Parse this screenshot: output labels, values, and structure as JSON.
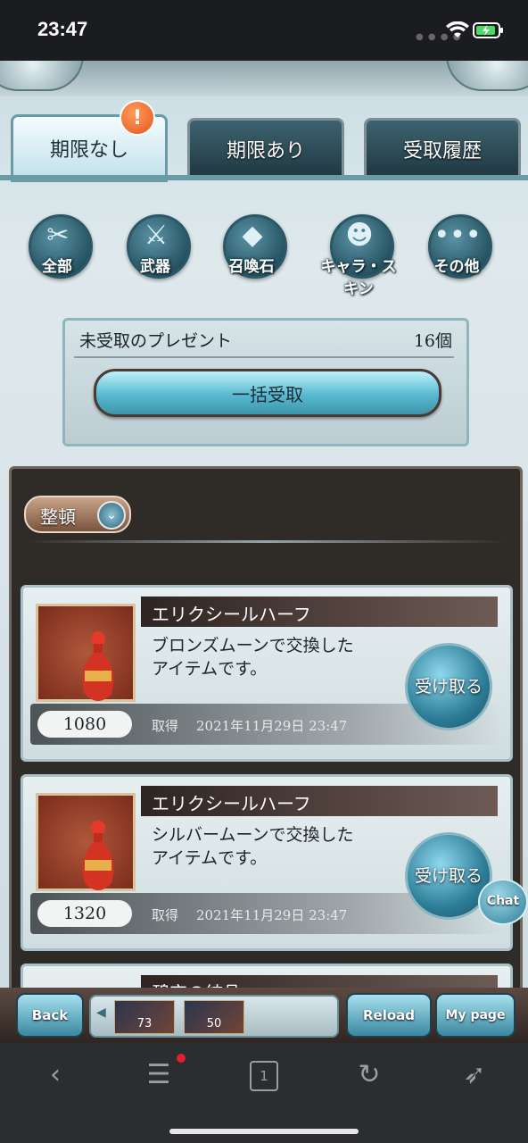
{
  "status_bar": {
    "time": "23:47"
  },
  "tabs": [
    {
      "label": "期限なし",
      "active": true
    },
    {
      "label": "期限あり",
      "active": false
    },
    {
      "label": "受取履歴",
      "active": false
    }
  ],
  "notification_badge": "!",
  "categories": [
    {
      "label": "全部",
      "icon": "all-icon"
    },
    {
      "label": "武器",
      "icon": "sword-icon"
    },
    {
      "label": "召喚石",
      "icon": "crystal-icon"
    },
    {
      "label": "キャラ・スキン",
      "icon": "character-icon"
    },
    {
      "label": "その他",
      "icon": "more-icon"
    }
  ],
  "present_box": {
    "label": "未受取のプレゼント",
    "count": "16個",
    "bulk_button": "一括受取"
  },
  "sort": {
    "label": "整頓"
  },
  "items": [
    {
      "name": "エリクシールハーフ",
      "desc_line1": "ブロンズムーンで交換した",
      "desc_line2": "アイテムです。",
      "quantity": "1080",
      "acquired_label": "取得",
      "date": "2021年11月29日 23:47",
      "claim_button": "受け取る"
    },
    {
      "name": "エリクシールハーフ",
      "desc_line1": "シルバームーンで交換した",
      "desc_line2": "アイテムです。",
      "quantity": "1320",
      "acquired_label": "取得",
      "date": "2021年11月29日 23:47",
      "claim_button": "受け取る"
    }
  ],
  "partial_item": {
    "name": "碧空の結晶"
  },
  "chat_button": "Chat",
  "game_bar": {
    "back": "Back",
    "reload": "Reload",
    "mypage": "My page",
    "shortcuts": [
      "73",
      "50"
    ]
  },
  "colors": {
    "accent": "#58b9d0",
    "panel_dark": "#2f2b27",
    "badge": "#e2581b"
  }
}
